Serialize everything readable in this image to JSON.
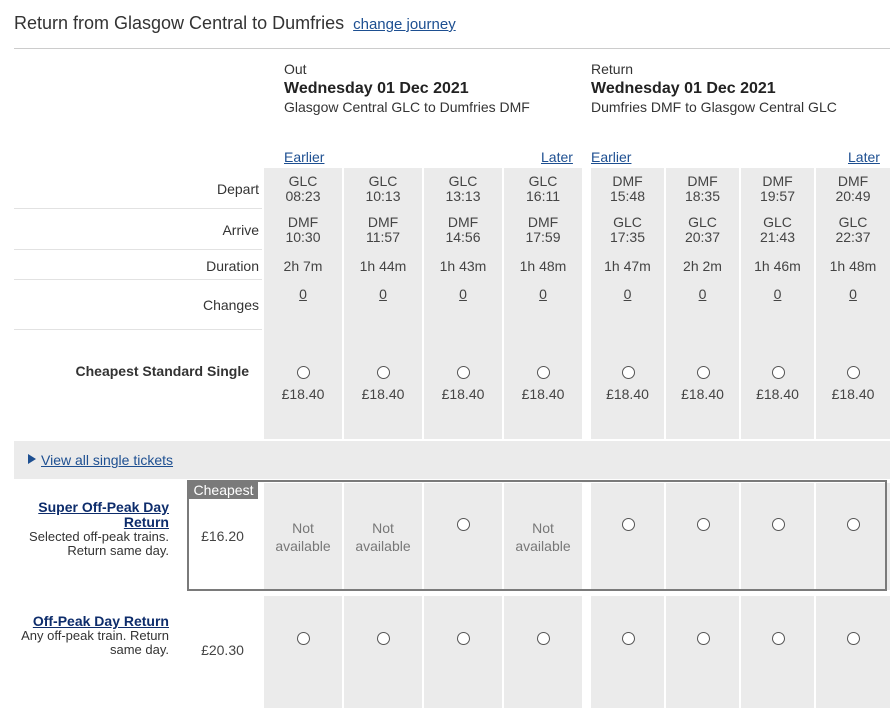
{
  "header": {
    "title": "Return from Glasgow Central to Dumfries",
    "change_link": "change journey"
  },
  "outbound": {
    "label": "Out",
    "date": "Wednesday 01 Dec 2021",
    "route": "Glasgow Central GLC to Dumfries DMF",
    "earlier": "Earlier",
    "later": "Later"
  },
  "inbound": {
    "label": "Return",
    "date": "Wednesday 01 Dec 2021",
    "route": "Dumfries DMF to Glasgow Central GLC",
    "earlier": "Earlier",
    "later": "Later"
  },
  "row_labels": {
    "depart": "Depart",
    "arrive": "Arrive",
    "duration": "Duration",
    "changes": "Changes",
    "cheapest_single": "Cheapest Standard Single"
  },
  "trains": [
    {
      "dep_stn": "GLC",
      "dep_time": "08:23",
      "arr_stn": "DMF",
      "arr_time": "10:30",
      "duration": "2h 7m",
      "changes": "0",
      "single": "£18.40"
    },
    {
      "dep_stn": "GLC",
      "dep_time": "10:13",
      "arr_stn": "DMF",
      "arr_time": "11:57",
      "duration": "1h 44m",
      "changes": "0",
      "single": "£18.40"
    },
    {
      "dep_stn": "GLC",
      "dep_time": "13:13",
      "arr_stn": "DMF",
      "arr_time": "14:56",
      "duration": "1h 43m",
      "changes": "0",
      "single": "£18.40"
    },
    {
      "dep_stn": "GLC",
      "dep_time": "16:11",
      "arr_stn": "DMF",
      "arr_time": "17:59",
      "duration": "1h 48m",
      "changes": "0",
      "single": "£18.40"
    },
    {
      "dep_stn": "DMF",
      "dep_time": "15:48",
      "arr_stn": "GLC",
      "arr_time": "17:35",
      "duration": "1h 47m",
      "changes": "0",
      "single": "£18.40"
    },
    {
      "dep_stn": "DMF",
      "dep_time": "18:35",
      "arr_stn": "GLC",
      "arr_time": "20:37",
      "duration": "2h 2m",
      "changes": "0",
      "single": "£18.40"
    },
    {
      "dep_stn": "DMF",
      "dep_time": "19:57",
      "arr_stn": "GLC",
      "arr_time": "21:43",
      "duration": "1h 46m",
      "changes": "0",
      "single": "£18.40"
    },
    {
      "dep_stn": "DMF",
      "dep_time": "20:49",
      "arr_stn": "GLC",
      "arr_time": "22:37",
      "duration": "1h 48m",
      "changes": "0",
      "single": "£18.40"
    }
  ],
  "view_all": "View all single tickets",
  "fares": [
    {
      "name": "Super Off-Peak Day Return",
      "description": "Selected off-peak trains. Return same day.",
      "price": "£16.20",
      "badge": "Cheapest",
      "availability": [
        "Not available",
        "Not available",
        "radio",
        "Not available",
        "radio",
        "radio",
        "radio",
        "radio"
      ]
    },
    {
      "name": "Off-Peak Day Return",
      "description": "Any off-peak train. Return same day.",
      "price": "£20.30",
      "availability": [
        "radio",
        "radio",
        "radio",
        "radio",
        "radio",
        "radio",
        "radio",
        "radio"
      ]
    }
  ],
  "colors": {
    "link": "#1d4f91",
    "column_bg": "#ebebeb",
    "highlight_border": "#7a7a7a"
  }
}
